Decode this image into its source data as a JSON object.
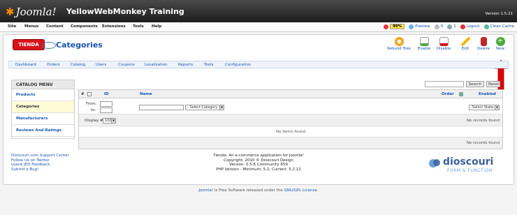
{
  "header": {
    "brand": "Joomla!",
    "site_title": "YellowWebMonkey Training",
    "version": "Version 1.5.21"
  },
  "menu": [
    "Site",
    "Menus",
    "Content",
    "Components",
    "Extensions",
    "Tools",
    "Help"
  ],
  "status": {
    "percent": "99%",
    "preview": "Preview",
    "messages": "0",
    "users": "1",
    "logout": "Logout",
    "clean_cache": "Clean Cache"
  },
  "brand_logo": "TIENDA",
  "page_title": "Categories",
  "toolbar": [
    {
      "label": "Rebuild Tree",
      "icon": "rebuild-tree-icon",
      "color": "#f7a21b"
    },
    {
      "label": "Enable",
      "icon": "enable-icon",
      "color": "#5aa33b"
    },
    {
      "label": "Disable",
      "icon": "disable-icon",
      "color": "#d8141b"
    },
    {
      "label": "Edit",
      "icon": "edit-icon",
      "color": "#f5b400"
    },
    {
      "label": "Delete",
      "icon": "delete-icon",
      "color": "#c0252a"
    },
    {
      "label": "New",
      "icon": "new-icon",
      "color": "#4cab3a"
    }
  ],
  "submenu": [
    "Dashboard",
    "Orders",
    "Catalog",
    "Users",
    "Coupons",
    "Localization",
    "Reports",
    "Tools",
    "Configuration"
  ],
  "catalog_menu": {
    "heading": "CATALOG MENU",
    "items": [
      "Products",
      "Categories",
      "Manufacturers",
      "Reviews And Ratings"
    ],
    "active_index": 1
  },
  "search": {
    "button": "Search",
    "reset": "Reset"
  },
  "table": {
    "headers": {
      "num": "#",
      "id": "ID",
      "name": "Name",
      "order": "Order",
      "enabled": "Enabled"
    },
    "filters": {
      "from": "From:",
      "to": "to:",
      "category_select": "- Select Category -",
      "state_select": "-Select State-"
    },
    "display_label": "Display #",
    "display_value": "100",
    "no_records": "No records found",
    "no_items": "No items found"
  },
  "footer": {
    "links": [
      "Dioscouri.com Support Center",
      "Follow Us on Twitter",
      "Leave JED Feedback",
      "Submit a Bug!"
    ],
    "center_lines": [
      "Tienda: An e-commerce application for Joomla!",
      "Copyright: 2010 © Dioscouri Design",
      "Version: 0.5.6 Community 659",
      "PHP Version - Minimum: 5.2; Current: 5.2.12"
    ],
    "logo_name": "dioscouri",
    "logo_tagline": "FORM & FUNCTION"
  },
  "bottom": {
    "joomla": "Joomla!",
    "middle": " is Free Software released under the ",
    "license": "GNU/GPL License."
  }
}
